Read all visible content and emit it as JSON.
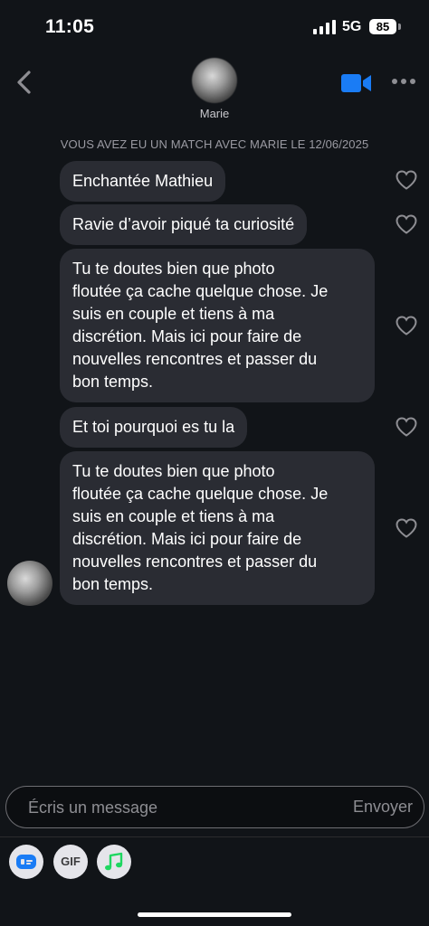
{
  "status": {
    "time": "11:05",
    "network": "5G",
    "battery": "85"
  },
  "header": {
    "contact_name": "Marie"
  },
  "match_note": "VOUS AVEZ EU UN MATCH AVEC MARIE LE 12/06/2025",
  "messages": [
    {
      "text": "Enchantée Mathieu"
    },
    {
      "text": "Ravie d’avoir piqué ta curiosité"
    },
    {
      "text": "Tu te doutes bien que photo\nfloutée ça cache quelque chose. Je\nsuis en couple et tiens à ma\ndiscrétion. Mais ici pour faire de\nnouvelles rencontres et passer du\nbon temps."
    },
    {
      "text": "Et toi pourquoi es tu la"
    },
    {
      "text": "Tu te doutes bien que photo\nfloutée ça cache quelque chose. Je\nsuis en couple et tiens à ma\ndiscrétion. Mais ici pour faire de\nnouvelles rencontres et passer du\nbon temps."
    }
  ],
  "composer": {
    "placeholder": "Écris un message",
    "send_label": "Envoyer"
  },
  "toolbar": {
    "gif_label": "GIF"
  },
  "icons": {
    "back": "chevron-left-icon",
    "video": "video-camera-icon",
    "more": "more-horizontal-icon",
    "like": "heart-outline-icon",
    "sticker": "sticker-icon",
    "music": "music-note-icon"
  },
  "colors": {
    "accent": "#1a7cf5",
    "music": "#1ed760",
    "background": "#111418",
    "bubble": "#2a2c33"
  }
}
